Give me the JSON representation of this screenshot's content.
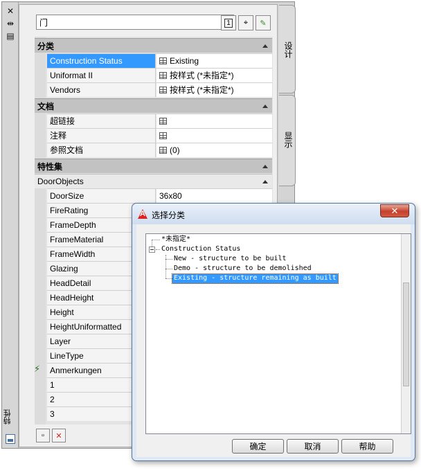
{
  "palette": {
    "title": "特性",
    "style_value": "门",
    "tabs": [
      {
        "label": "设计"
      },
      {
        "label": "显示"
      }
    ],
    "categories": [
      {
        "label": "分类",
        "rows": [
          {
            "name": "Construction Status",
            "value": "Existing",
            "selected": true
          },
          {
            "name": "Uniformat II",
            "value": "按样式 (*未指定*)"
          },
          {
            "name": "Vendors",
            "value": "按样式 (*未指定*)"
          }
        ]
      },
      {
        "label": "文档",
        "rows": [
          {
            "name": "超链接",
            "value": ""
          },
          {
            "name": "注释",
            "value": ""
          },
          {
            "name": "参照文档",
            "value": "(0)"
          }
        ]
      },
      {
        "label": "特性集",
        "subgroup": "DoorObjects",
        "rows": [
          {
            "name": "DoorSize",
            "value": "36x80"
          },
          {
            "name": "FireRating",
            "value": ""
          },
          {
            "name": "FrameDepth",
            "value": ""
          },
          {
            "name": "FrameMaterial",
            "value": ""
          },
          {
            "name": "FrameWidth",
            "value": ""
          },
          {
            "name": "Glazing",
            "value": ""
          },
          {
            "name": "HeadDetail",
            "value": ""
          },
          {
            "name": "HeadHeight",
            "value": ""
          },
          {
            "name": "Height",
            "value": ""
          },
          {
            "name": "HeightUniformatted",
            "value": ""
          },
          {
            "name": "Layer",
            "value": ""
          },
          {
            "name": "LineType",
            "value": ""
          },
          {
            "name": "Anmerkungen",
            "value": ""
          },
          {
            "name": "1",
            "value": ""
          },
          {
            "name": "2",
            "value": ""
          },
          {
            "name": "3",
            "value": ""
          }
        ]
      }
    ]
  },
  "dialog": {
    "title": "选择分类",
    "tree": {
      "root": "*未指定*",
      "parent": "Construction Status",
      "children": [
        "New - structure to be built",
        "Demo - structure to be demolished",
        "Existing - structure remaining as built"
      ]
    },
    "buttons": {
      "ok": "确定",
      "cancel": "取消",
      "help": "帮助"
    }
  },
  "colors": {
    "selection": "#3399ff",
    "close_button": "#c5412c"
  }
}
